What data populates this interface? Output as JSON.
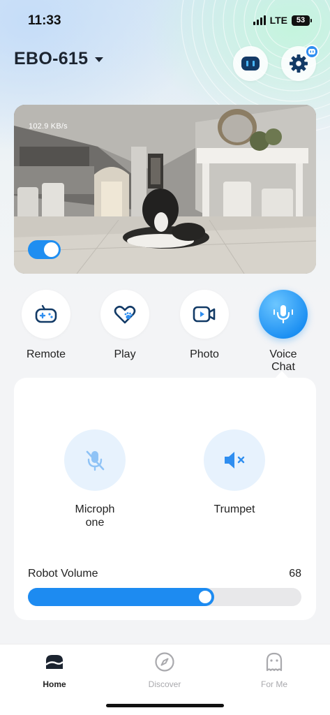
{
  "status_bar": {
    "time": "11:33",
    "network": "LTE",
    "battery": "53"
  },
  "header": {
    "device_name": "EBO-615"
  },
  "camera": {
    "data_rate": "102.9 KB/s",
    "live_enabled": true
  },
  "actions": [
    {
      "label": "Remote",
      "icon": "gamepad-icon",
      "active": false
    },
    {
      "label": "Play",
      "icon": "heart-paw-icon",
      "active": false
    },
    {
      "label": "Photo",
      "icon": "video-camera-icon",
      "active": false
    },
    {
      "label": "Voice Chat",
      "icon": "microphone-icon",
      "active": true
    }
  ],
  "voice_panel": {
    "microphone": {
      "label": "Microph one",
      "icon": "microphone-muted-icon",
      "state": "muted"
    },
    "trumpet": {
      "label": "Trumpet",
      "icon": "speaker-muted-icon",
      "state": "muted"
    },
    "volume": {
      "label": "Robot Volume",
      "value": "68",
      "level": 0.68
    }
  },
  "tabs": [
    {
      "label": "Home",
      "icon": "home-icon",
      "active": true
    },
    {
      "label": "Discover",
      "icon": "compass-icon",
      "active": false
    },
    {
      "label": "For Me",
      "icon": "ghost-profile-icon",
      "active": false
    }
  ],
  "colors": {
    "accent": "#1d8bf1",
    "panel_circle": "#e7f2fd",
    "inactive_tab": "#a9a9ad"
  }
}
